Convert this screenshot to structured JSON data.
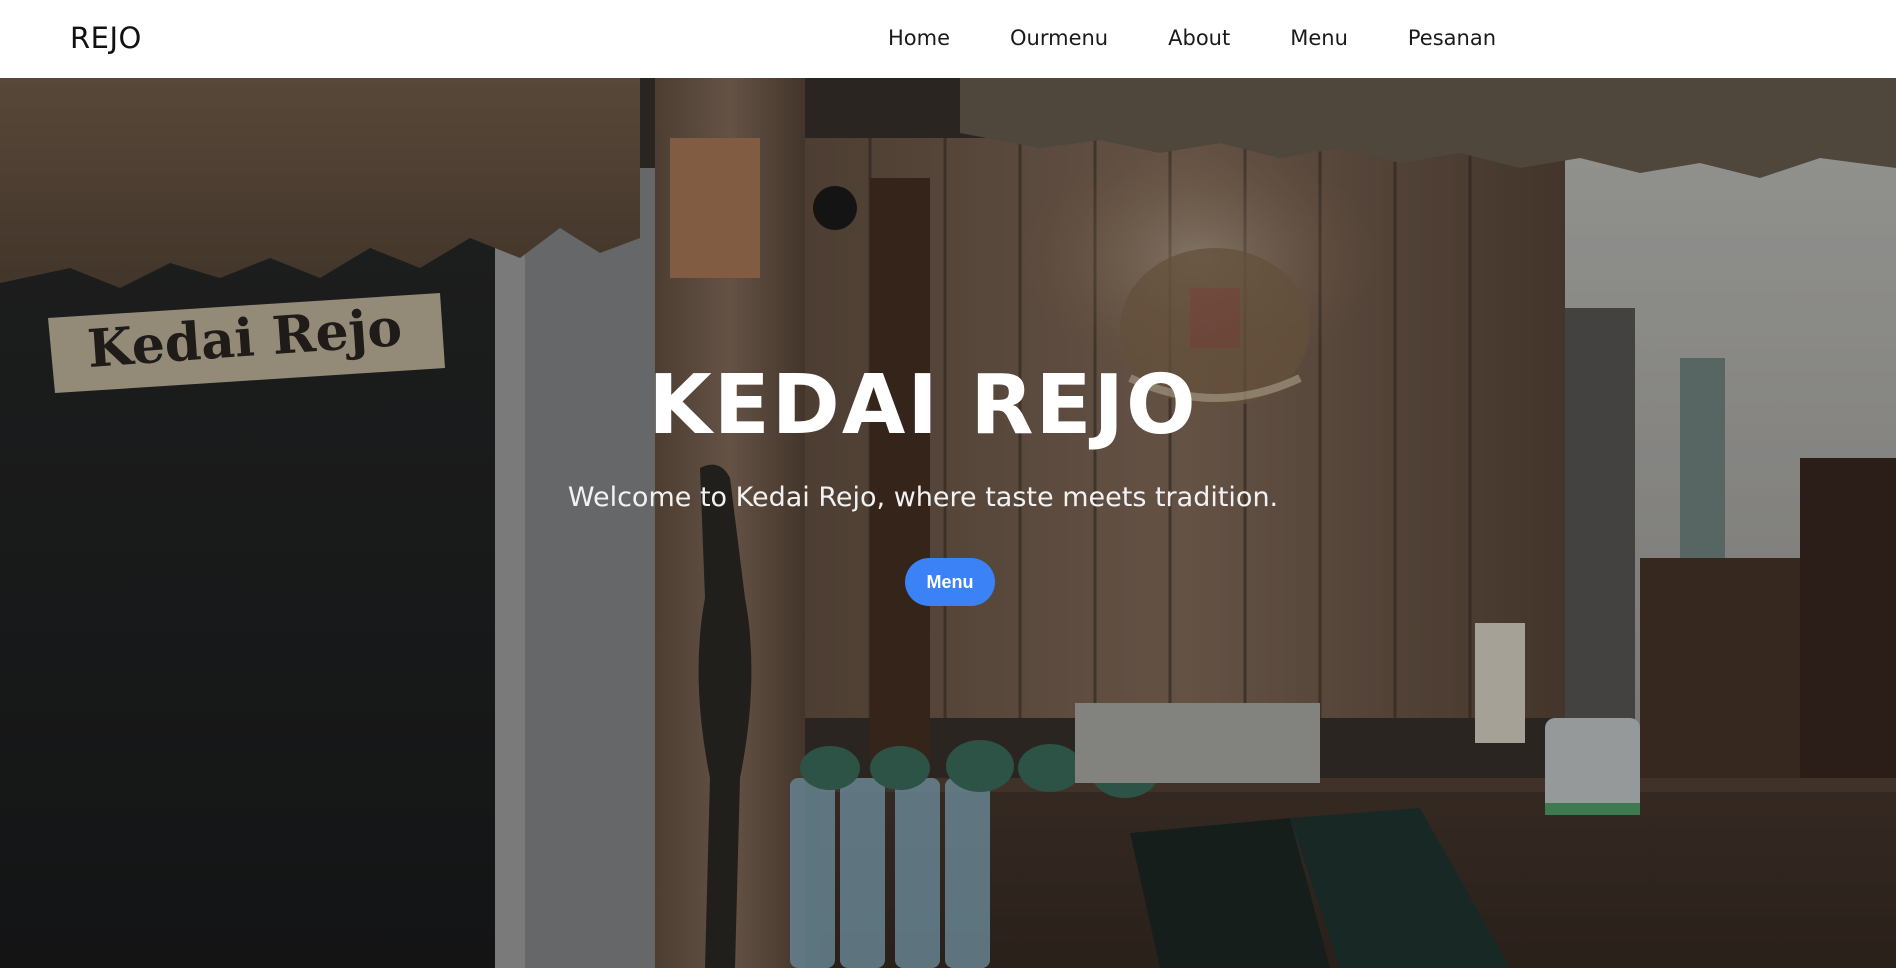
{
  "navbar": {
    "brand": "REJO",
    "links": [
      "Home",
      "Ourmenu",
      "About",
      "Menu",
      "Pesanan"
    ]
  },
  "hero": {
    "title": "KEDAI REJO",
    "subtitle": "Welcome to Kedai Rejo, where taste meets tradition.",
    "button_label": "Menu",
    "sign_text": "Kedai Rejo"
  },
  "colors": {
    "accent": "#3b82f6",
    "nav_bg": "#ffffff",
    "hero_text": "#ffffff"
  }
}
